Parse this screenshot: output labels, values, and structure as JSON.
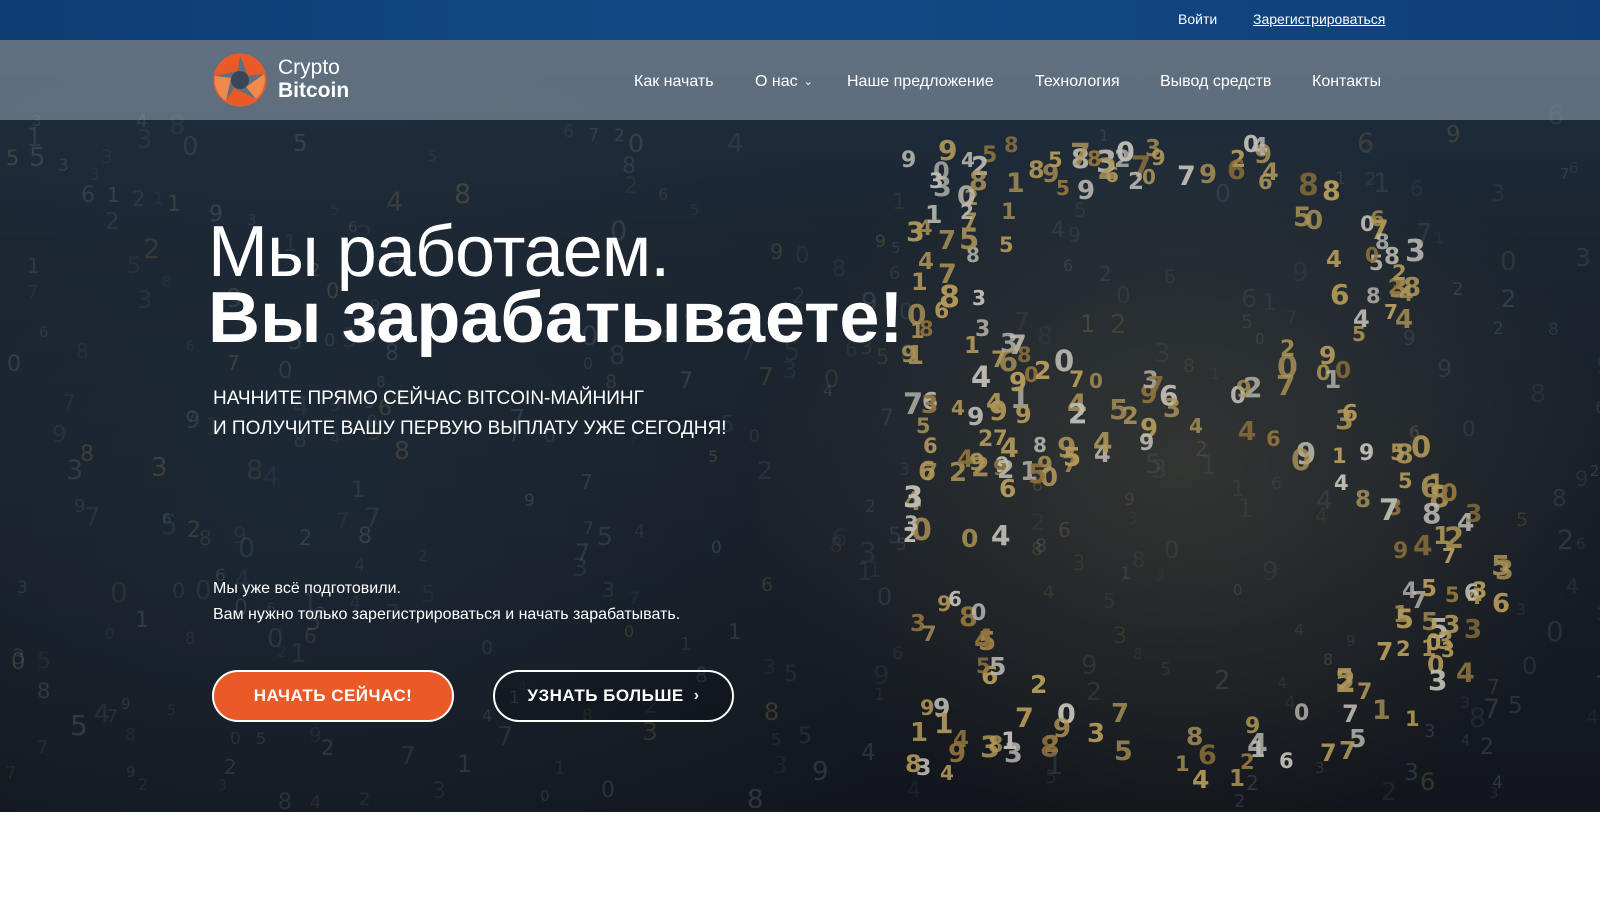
{
  "topbar": {
    "login": "Войти",
    "register": "Зарегистрироваться"
  },
  "logo": {
    "line1": "Crypto",
    "line2": "Bitcoin",
    "icon": "aperture-logo-icon"
  },
  "nav": {
    "items": [
      {
        "label": "Как начать"
      },
      {
        "label": "О нас",
        "icon": "chevron-down-icon"
      },
      {
        "label": "Наше предложение"
      },
      {
        "label": "Технология"
      },
      {
        "label": "Вывод средств"
      },
      {
        "label": "Контакты"
      }
    ]
  },
  "hero": {
    "headline_light": "Мы работаем.",
    "headline_bold": "Вы зарабатываете!",
    "subtitle_line1": "НАЧНИТЕ ПРЯМО СЕЙЧАС BITCOIN-МАЙНИНГ",
    "subtitle_line2": "И ПОЛУЧИТЕ ВАШУ ПЕРВУЮ ВЫПЛАТУ УЖЕ СЕГОДНЯ!",
    "note_line1": "Мы уже всё подготовили.",
    "note_line2": "Вам нужно только зарегистрироваться и начать зарабатывать.",
    "cta_primary": "НАЧАТЬ СЕЙЧАС!",
    "cta_secondary": "УЗНАТЬ БОЛЬШЕ",
    "cta_secondary_icon": "chevron-right-icon"
  },
  "colors": {
    "accent": "#ea5a28",
    "topbar": "#134a86",
    "gold": "#d4b062"
  }
}
